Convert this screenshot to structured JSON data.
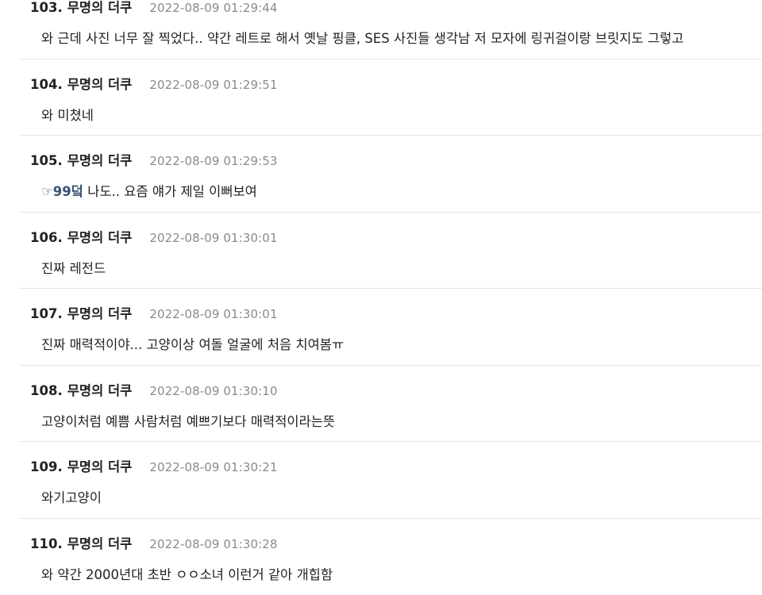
{
  "comments": [
    {
      "number": "103.",
      "author": "무명의 더쿠",
      "date": "2022-08-09 01:29:44",
      "text": "와 근데 사진 너무 잘 찍었다.. 약간 레트로 해서 옛날 핑클, SES 사진들 생각남 저 모자에 링귀걸이랑 브릿지도 그렇고"
    },
    {
      "number": "104.",
      "author": "무명의 더쿠",
      "date": "2022-08-09 01:29:51",
      "text": "와 미쳤네"
    },
    {
      "number": "105.",
      "author": "무명의 더쿠",
      "date": "2022-08-09 01:29:53",
      "reply_icon": "☞",
      "reply_target": "99덬",
      "text": " 나도.. 요즘 얘가 제일 이뻐보여"
    },
    {
      "number": "106.",
      "author": "무명의 더쿠",
      "date": "2022-08-09 01:30:01",
      "text": "진짜 레전드"
    },
    {
      "number": "107.",
      "author": "무명의 더쿠",
      "date": "2022-08-09 01:30:01",
      "text": "진짜 매력적이야... 고양이상 여돌 얼굴에 처음 치여봄ㅠ"
    },
    {
      "number": "108.",
      "author": "무명의 더쿠",
      "date": "2022-08-09 01:30:10",
      "text": "고양이처럼 예쁨 사람처럼 예쁘기보다 매력적이라는뜻"
    },
    {
      "number": "109.",
      "author": "무명의 더쿠",
      "date": "2022-08-09 01:30:21",
      "text": "와기고양이"
    },
    {
      "number": "110.",
      "author": "무명의 더쿠",
      "date": "2022-08-09 01:30:28",
      "text": "와 약간 2000년대 초반 ㅇㅇ소녀 이런거 같아 개힙함"
    }
  ]
}
